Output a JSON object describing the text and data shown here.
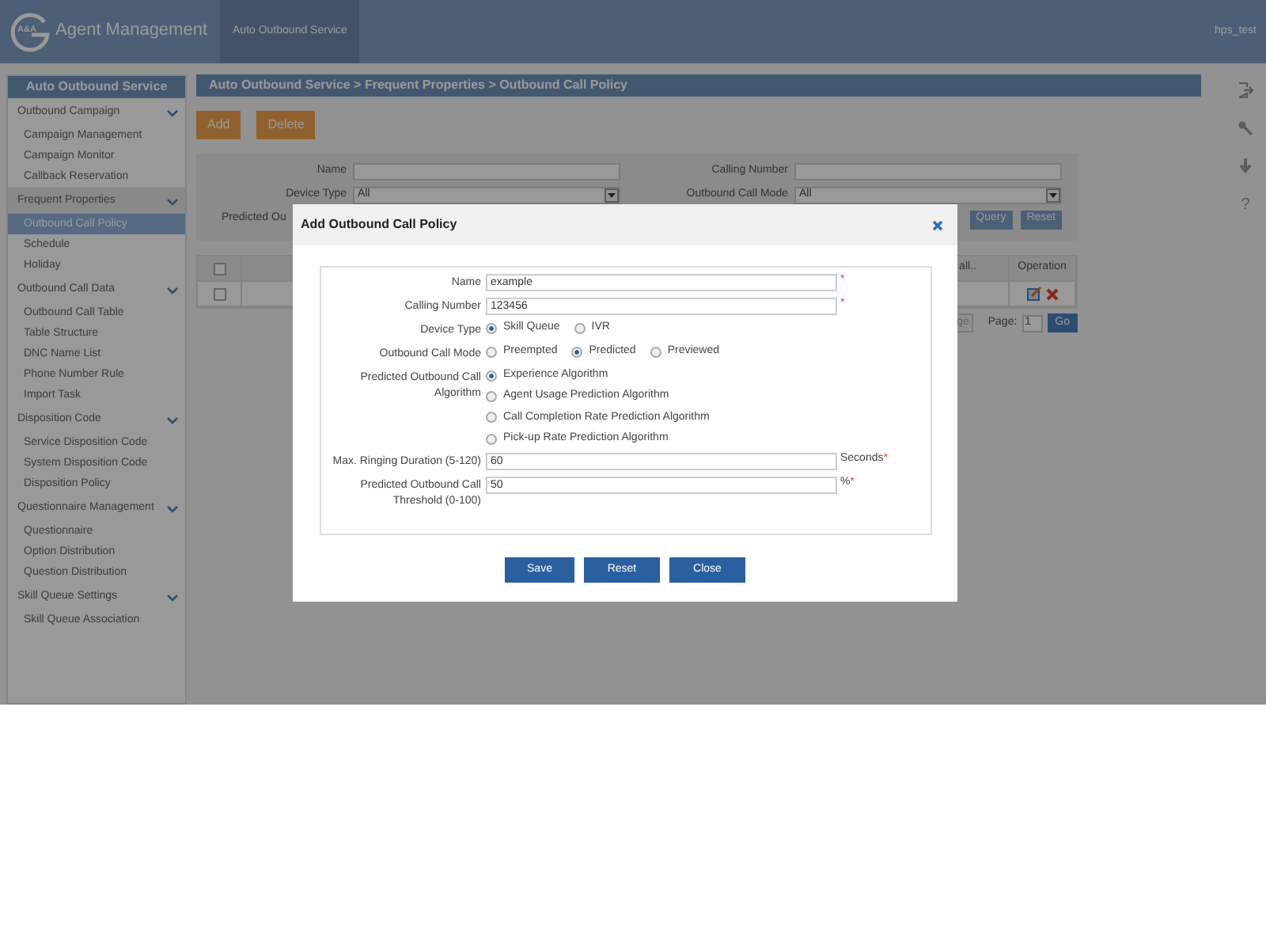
{
  "header": {
    "app_title": "Agent Management",
    "logo_text": "A&A",
    "tabs": [
      {
        "label": "Auto Outbound Service",
        "selected": true
      }
    ],
    "user": "hps_test"
  },
  "sidebar": {
    "title": "Auto Outbound Service",
    "groups": [
      {
        "label": "Outbound Campaign",
        "selected": false,
        "items": [
          {
            "label": "Campaign Management",
            "selected": false
          },
          {
            "label": "Campaign Monitor",
            "selected": false
          },
          {
            "label": "Callback Reservation",
            "selected": false
          }
        ]
      },
      {
        "label": "Frequent Properties",
        "selected": true,
        "items": [
          {
            "label": "Outbound Call Policy",
            "selected": true
          },
          {
            "label": "Schedule",
            "selected": false
          },
          {
            "label": "Holiday",
            "selected": false
          }
        ]
      },
      {
        "label": "Outbound Call Data",
        "selected": false,
        "items": [
          {
            "label": "Outbound Call Table",
            "selected": false
          },
          {
            "label": "Table Structure",
            "selected": false
          },
          {
            "label": "DNC Name List",
            "selected": false
          },
          {
            "label": "Phone Number Rule",
            "selected": false
          },
          {
            "label": "Import Task",
            "selected": false
          }
        ]
      },
      {
        "label": "Disposition Code",
        "selected": false,
        "items": [
          {
            "label": "Service Disposition Code",
            "selected": false
          },
          {
            "label": "System Disposition Code",
            "selected": false
          },
          {
            "label": "Disposition Policy",
            "selected": false
          }
        ]
      },
      {
        "label": "Questionnaire Management",
        "selected": false,
        "items": [
          {
            "label": "Questionnaire",
            "selected": false
          },
          {
            "label": "Option Distribution",
            "selected": false
          },
          {
            "label": "Question Distribution",
            "selected": false
          }
        ]
      },
      {
        "label": "Skill Queue Settings",
        "selected": false,
        "items": [
          {
            "label": "Skill Queue Association",
            "selected": false
          }
        ]
      }
    ]
  },
  "breadcrumb": "Auto Outbound Service > Frequent Properties > Outbound Call Policy",
  "toolbar": [
    "Add",
    "Delete"
  ],
  "filter": {
    "rows": [
      [
        {
          "label": "Name",
          "kind": "text"
        },
        {
          "label": "Calling Number",
          "kind": "text"
        }
      ],
      [
        {
          "label": "Device Type",
          "kind": "select",
          "value": "All"
        },
        {
          "label": "Outbound Call Mode",
          "kind": "select",
          "value": "All"
        }
      ],
      [
        {
          "label": "Predicted Ou",
          "kind": "label"
        }
      ]
    ],
    "buttons": [
      "Query",
      "Reset"
    ]
  },
  "table": {
    "columns": [
      {
        "kind": "checkbox",
        "checked": false
      },
      {
        "kind": "text",
        "label": "all.."
      },
      {
        "kind": "text",
        "label": "Operation"
      }
    ],
    "rows": [
      {
        "checked": false
      }
    ]
  },
  "pager": {
    "button": "ge",
    "page_label": "Page:",
    "page": "1",
    "go": "Go"
  },
  "right_toolbar": {
    "help": "?"
  },
  "dialog": {
    "title": "Add Outbound Call Policy",
    "fields": [
      {
        "kind": "text",
        "label": "Name",
        "value": "example",
        "required_mark": "*"
      },
      {
        "kind": "text",
        "label": "Calling Number",
        "value": "123456",
        "required_mark": "*"
      },
      {
        "kind": "radio",
        "stacked": false,
        "label": "Device Type",
        "options": [
          {
            "label": "Skill Queue",
            "selected": true
          },
          {
            "label": "IVR",
            "selected": false
          }
        ]
      },
      {
        "kind": "radio",
        "stacked": false,
        "label": "Outbound Call Mode",
        "options": [
          {
            "label": "Preempted",
            "selected": false
          },
          {
            "label": "Predicted",
            "selected": true
          },
          {
            "label": "Previewed",
            "selected": false
          }
        ]
      },
      {
        "kind": "radio",
        "stacked": true,
        "label": "Predicted Outbound Call Algorithm",
        "options": [
          {
            "label": "Experience Algorithm",
            "selected": true
          },
          {
            "label": "Agent Usage Prediction Algorithm",
            "selected": false
          },
          {
            "label": "Call Completion Rate Prediction Algorithm",
            "selected": false
          },
          {
            "label": "Pick-up Rate Prediction Algorithm",
            "selected": false
          }
        ]
      },
      {
        "kind": "text",
        "label": "Max. Ringing Duration (5-120)",
        "value": "60",
        "suffix": "Seconds",
        "required_mark": "*"
      },
      {
        "kind": "text",
        "label": "Predicted Outbound Call Threshold (0-100)",
        "value": "50",
        "suffix": "%",
        "required_mark": "*"
      }
    ],
    "buttons": [
      "Save",
      "Reset",
      "Close"
    ]
  }
}
